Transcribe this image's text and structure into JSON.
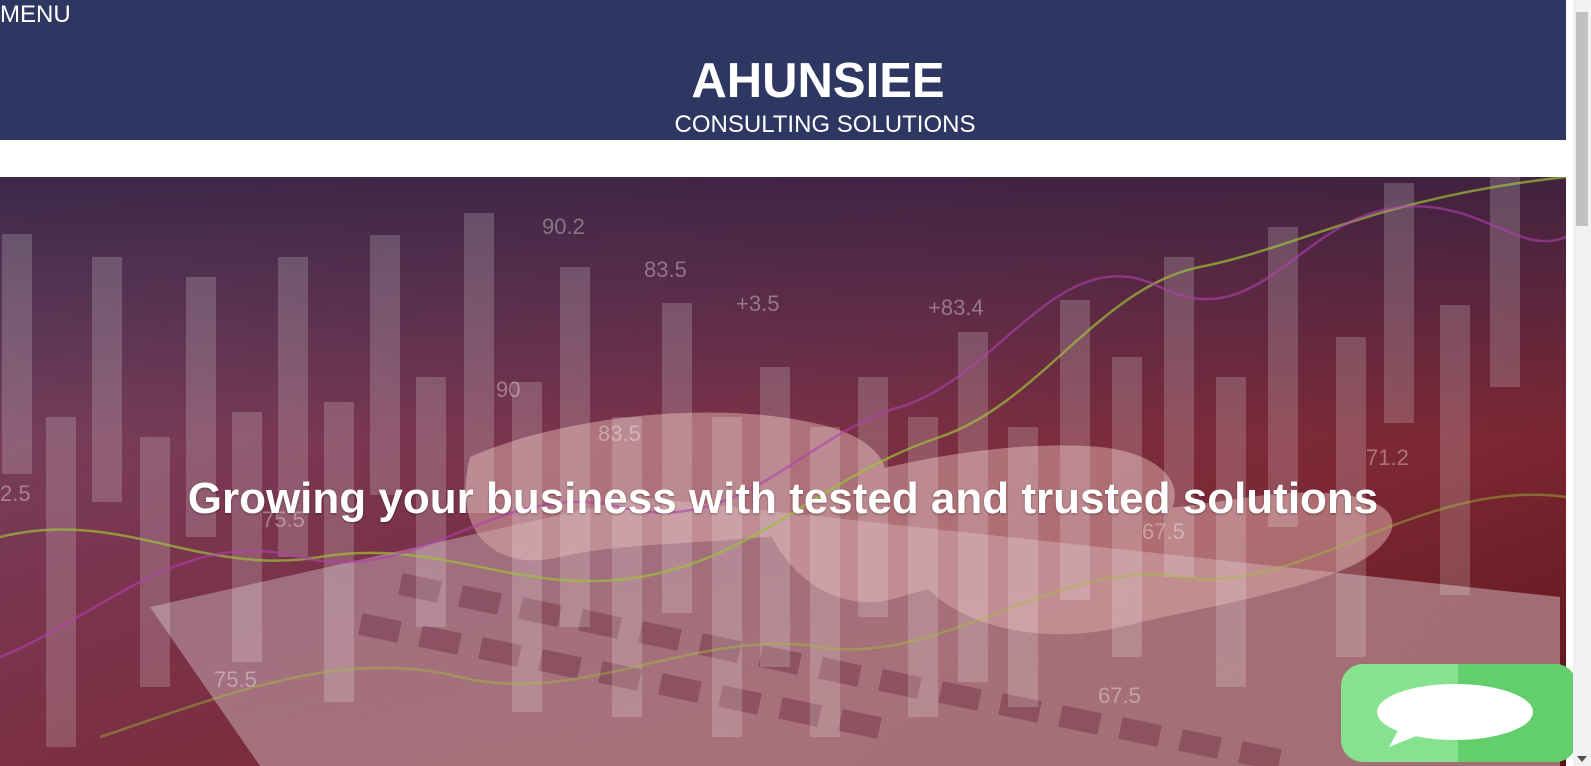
{
  "header": {
    "menu_label": "MENU",
    "brand_title": "AHUNSIEE",
    "brand_subtitle": "CONSULTING SOLUTIONS",
    "background_color": "#2e3762"
  },
  "hero": {
    "heading": "Growing your business with tested and trusted solutions",
    "overlay_numbers": [
      "90.2",
      "83.5",
      "+3.5",
      "+83.4",
      "90",
      "83.5",
      "71.2",
      "67.5",
      "2.5",
      "75.5",
      "75.5",
      "67.5"
    ]
  },
  "chat_widget": {
    "icon": "chat-bubble-icon",
    "color": "#86e28e"
  },
  "scrollbar": {
    "icon": "scroll-down-arrow-icon"
  }
}
